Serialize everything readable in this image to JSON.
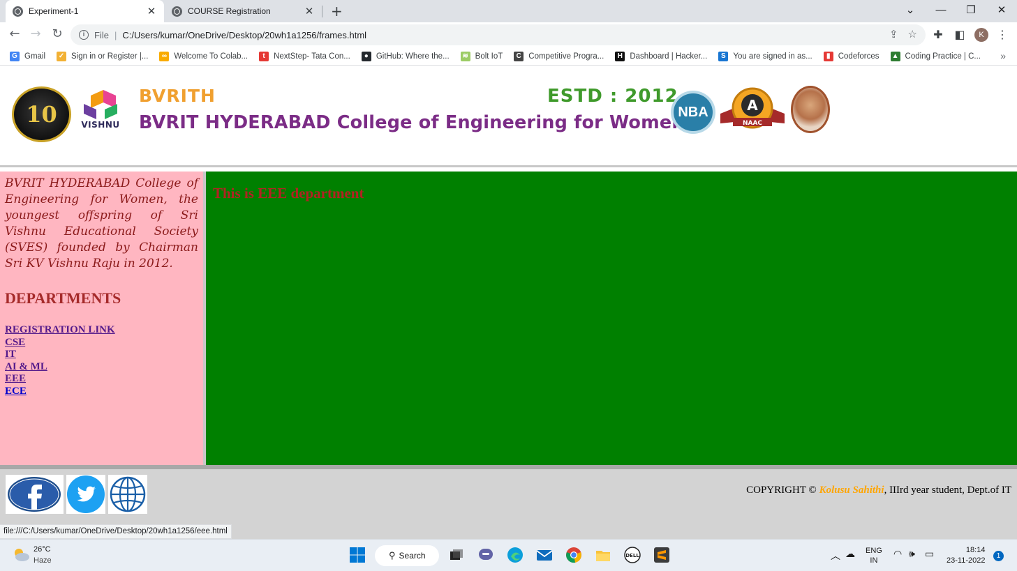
{
  "browser": {
    "tabs": [
      {
        "title": "Experiment-1",
        "active": true
      },
      {
        "title": "COURSE Registration",
        "active": false
      }
    ],
    "new_tab": "+",
    "window_controls": {
      "chevron": "⌄",
      "minimize": "—",
      "restore": "❐",
      "close": "✕"
    },
    "address": {
      "scheme": "File",
      "separator": "|",
      "url": "C:/Users/kumar/OneDrive/Desktop/20wh1a1256/frames.html"
    },
    "profile_initial": "K",
    "bookmarks": [
      {
        "label": "Gmail",
        "icon": "gmail-icon",
        "color": "#4285f4",
        "glyph": "G"
      },
      {
        "label": "Sign in or Register |...",
        "icon": "register-icon",
        "color": "#f2b134",
        "glyph": "✓"
      },
      {
        "label": "Welcome To Colab...",
        "icon": "colab-icon",
        "color": "#f9ab00",
        "glyph": "∞"
      },
      {
        "label": "NextStep- Tata Con...",
        "icon": "tcs-icon",
        "color": "#e53935",
        "glyph": "t"
      },
      {
        "label": "GitHub: Where the...",
        "icon": "github-icon",
        "color": "#24292e",
        "glyph": "●"
      },
      {
        "label": "Bolt IoT",
        "icon": "bolt-iot-icon",
        "color": "#9ccc65",
        "glyph": "≋"
      },
      {
        "label": "Competitive Progra...",
        "icon": "codechef-icon",
        "color": "#444444",
        "glyph": "C"
      },
      {
        "label": "Dashboard | Hacker...",
        "icon": "hackerrank-icon",
        "color": "#111111",
        "glyph": "H"
      },
      {
        "label": "You are signed in as...",
        "icon": "signed-in-icon",
        "color": "#1976d2",
        "glyph": "S"
      },
      {
        "label": "Codeforces",
        "icon": "codeforces-icon",
        "color": "#e53935",
        "glyph": "▮"
      },
      {
        "label": "Coding Practice | C...",
        "icon": "coding-practice-icon",
        "color": "#2e7d32",
        "glyph": "▲"
      }
    ],
    "bookmarks_more": "»",
    "status_url": "file:///C:/Users/kumar/OneDrive/Desktop/20wh1a1256/eee.html"
  },
  "header": {
    "anniversary_logo": "10",
    "vishnu_label": "VISHNU",
    "short_name": "BVRITH",
    "estd": "ESTD : 2012",
    "college_name": "BVRIT HYDERABAD College of Engineering for Women",
    "nba_label": "NBA",
    "naac_label": "A",
    "naac_sub": "NAAC"
  },
  "sidebar": {
    "intro": "BVRIT HYDERABAD College of Engineering for Women, the youngest offspring of Sri Vishnu Educational Society (SVES) founded by Chairman Sri KV Vishnu Raju in 2012.",
    "departments_title": "DEPARTMENTS",
    "links": [
      {
        "label": "REGISTRATION LINK",
        "visited": true
      },
      {
        "label": "CSE",
        "visited": true
      },
      {
        "label": "IT",
        "visited": true
      },
      {
        "label": "AI & ML",
        "visited": true
      },
      {
        "label": "EEE",
        "visited": true
      },
      {
        "label": "ECE",
        "visited": false
      }
    ]
  },
  "main": {
    "heading": "This is EEE department",
    "background": "#008000"
  },
  "footer": {
    "copyright_prefix": "COPYRIGHT ©",
    "author": "Kolusu Sahithi",
    "copyright_suffix": ", IIIrd year student, Dept.of IT"
  },
  "taskbar": {
    "temperature": "26°C",
    "weather": "Haze",
    "search_label": "Search",
    "language_1": "ENG",
    "language_2": "IN",
    "time": "18:14",
    "date": "23-11-2022",
    "notifications": "1"
  },
  "colors": {
    "sidebar_bg": "#ffb6c1",
    "heading_red": "#b22222",
    "banner_purple": "#7b2c86",
    "banner_orange": "#f0a030",
    "banner_green": "#3f9a2b"
  }
}
